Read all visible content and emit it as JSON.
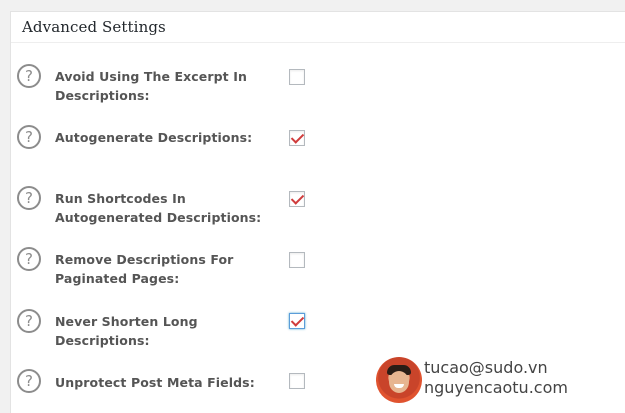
{
  "panel": {
    "title": "Advanced Settings"
  },
  "settings": [
    {
      "label": "Avoid Using The Excerpt In Descriptions:",
      "checked": false,
      "focused": false,
      "help_icon": "question-circle-icon"
    },
    {
      "label": "Autogenerate Descriptions:",
      "checked": true,
      "focused": false,
      "help_icon": "question-circle-icon"
    },
    {
      "label": "Run Shortcodes In Autogenerated Descriptions:",
      "checked": true,
      "focused": false,
      "help_icon": "question-circle-icon"
    },
    {
      "label": "Remove Descriptions For Paginated Pages:",
      "checked": false,
      "focused": false,
      "help_icon": "question-circle-icon"
    },
    {
      "label": "Never Shorten Long Descriptions:",
      "checked": true,
      "focused": true,
      "help_icon": "question-circle-icon"
    },
    {
      "label": "Unprotect Post Meta Fields:",
      "checked": false,
      "focused": false,
      "help_icon": "question-circle-icon"
    }
  ],
  "watermark": {
    "line1": "tucao@sudo.vn",
    "line2": "nguyencaotu.com"
  },
  "colors": {
    "checkmark": "#d03c3c",
    "label_text": "#555555",
    "focus_border": "#5b9dd9"
  }
}
